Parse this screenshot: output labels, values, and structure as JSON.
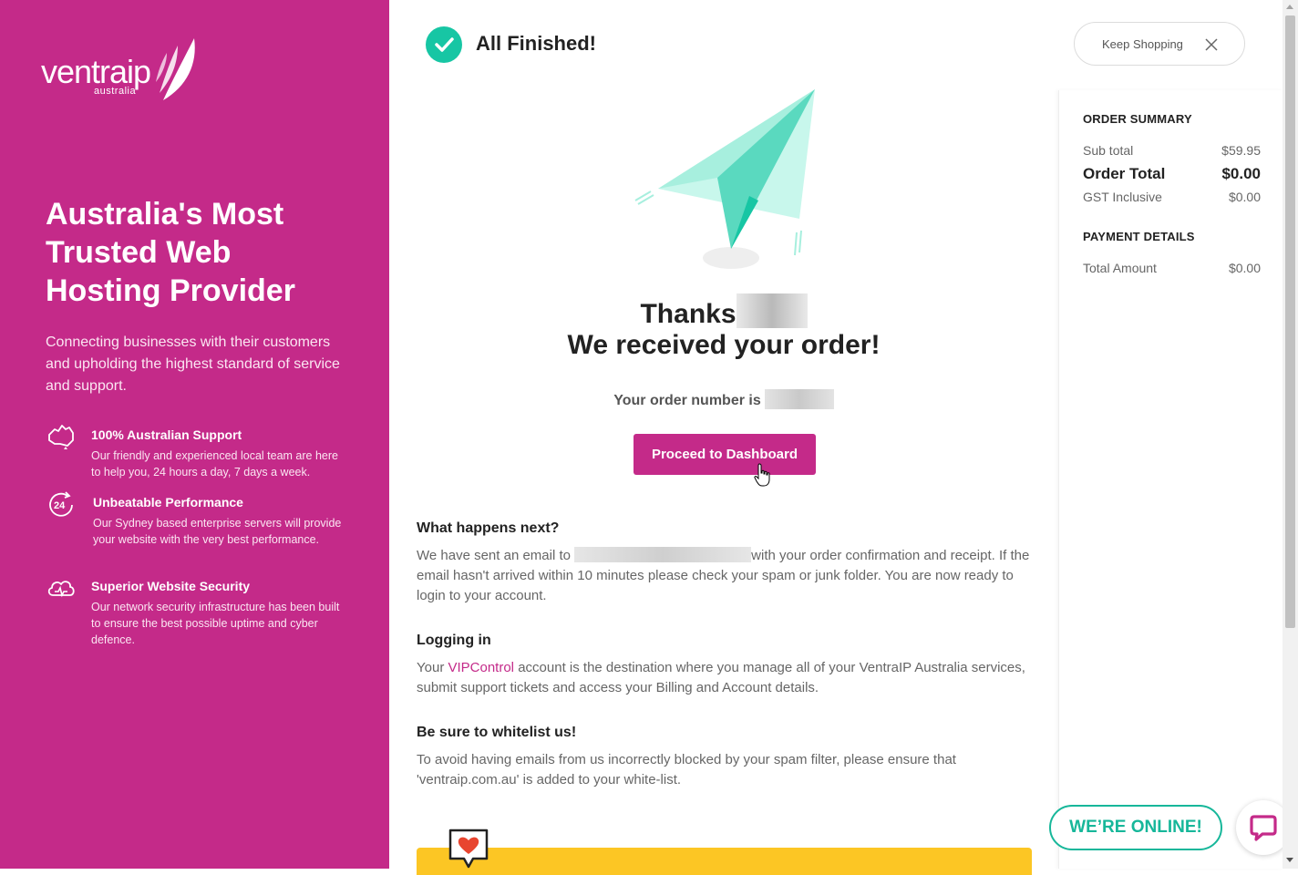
{
  "sidebar": {
    "logo_text": "ventraip",
    "logo_sub": "australia",
    "headline": "Australia's Most Trusted Web Hosting Provider",
    "intro": "Connecting businesses with their customers and upholding the highest standard of service and support.",
    "features": [
      {
        "icon": "australia-icon",
        "title": "100% Australian Support",
        "desc": "Our friendly and experienced local team are here to help you, 24 hours a day, 7 days a week."
      },
      {
        "icon": "24-hours-icon",
        "title": "Unbeatable Performance",
        "desc": "Our Sydney based enterprise servers will provide your website with the very best performance."
      },
      {
        "icon": "cloud-security-icon",
        "title": "Superior Website Security",
        "desc": "Our network security infrastructure has been built to ensure the best possible uptime and cyber defence."
      }
    ]
  },
  "main": {
    "status_title": "All Finished!",
    "thanks": "Thanks",
    "received": "We received your order!",
    "order_number_label": "Your order number is",
    "proceed_label": "Proceed to Dashboard",
    "sections": [
      {
        "title": "What happens next?",
        "text_before": "We have sent an email to",
        "text_after": "with your order confirmation and receipt. If the email hasn't arrived within 10 minutes please check your spam or junk folder. You are now ready to login to your account."
      },
      {
        "title": "Logging in",
        "text_before": "Your",
        "link": "VIPControl",
        "text_after": "account is the destination where you manage all of your VentraIP Australia services, submit support tickets and access your Billing and Account details."
      },
      {
        "title": "Be sure to whitelist us!",
        "text": "To avoid having emails from us incorrectly blocked by your spam filter, please ensure that 'ventraip.com.au' is added to your white-list."
      }
    ]
  },
  "header": {
    "keep_shopping": "Keep Shopping"
  },
  "summary": {
    "order_summary_heading": "ORDER SUMMARY",
    "rows": [
      {
        "label": "Sub total",
        "value": "$59.95"
      },
      {
        "label": "Order Total",
        "value": "$0.00"
      },
      {
        "label": "GST Inclusive",
        "value": "$0.00"
      }
    ],
    "payment_heading": "PAYMENT DETAILS",
    "payment_rows": [
      {
        "label": "Total Amount",
        "value": "$0.00"
      }
    ]
  },
  "chat": {
    "online_label": "WE’RE ONLINE!"
  },
  "colors": {
    "brand": "#c42a89",
    "accent": "#17c6a4",
    "banner": "#fcc624"
  }
}
